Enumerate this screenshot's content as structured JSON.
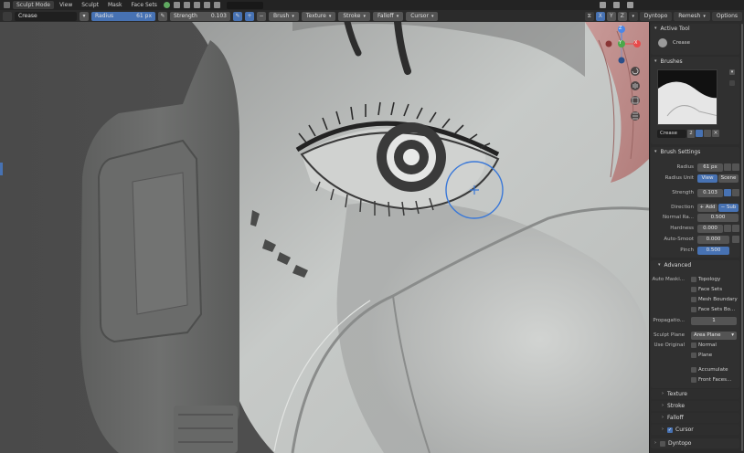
{
  "header": {
    "mode": "Sculpt Mode",
    "menus": [
      "View",
      "Sculpt",
      "Mask",
      "Face Sets"
    ]
  },
  "toolbar": {
    "tool_name": "Crease",
    "radius_label": "Radius",
    "radius_value": "61 px",
    "strength_label": "Strength",
    "strength_value": "0.103",
    "dropdowns": [
      "Brush",
      "Texture",
      "Stroke",
      "Falloff",
      "Cursor"
    ],
    "axes": [
      "X",
      "Y",
      "Z"
    ],
    "dyntopo": "Dyntopo",
    "remesh": "Remesh",
    "options": "Options"
  },
  "gizmo": {
    "x": "X",
    "y": "Y",
    "z": "Z"
  },
  "panel": {
    "active_tool": {
      "title": "Active Tool",
      "tool": "Crease"
    },
    "brushes": {
      "title": "Brushes",
      "brush_name": "Crease",
      "users": "2"
    },
    "brush_settings": {
      "title": "Brush Settings",
      "radius_label": "Radius",
      "radius_value": "61 px",
      "radius_unit_label": "Radius Unit",
      "unit_view": "View",
      "unit_scene": "Scene",
      "strength_label": "Strength",
      "strength_value": "0.103",
      "direction_label": "Direction",
      "dir_add": "+ Add",
      "dir_sub": "− Sub",
      "normal_radius_label": "Normal Ra...",
      "normal_radius_value": "0.500",
      "hardness_label": "Hardness",
      "hardness_value": "0.000",
      "auto_smooth_label": "Auto-Smoot",
      "auto_smooth_value": "0.000",
      "pinch_label": "Pinch",
      "pinch_value": "0.500"
    },
    "advanced": {
      "title": "Advanced",
      "auto_masking_label": "Auto Maski...",
      "mask_topology": "Topology",
      "mask_face_sets": "Face Sets",
      "mask_mesh_boundary": "Mesh Boundary",
      "mask_face_sets_boundary": "Face Sets Bo...",
      "propagation_label": "Propagatio...",
      "propagation_value": "1",
      "sculpt_plane_label": "Sculpt Plane",
      "sculpt_plane_value": "Area Plane",
      "use_original_label": "Use Original",
      "orig_normal": "Normal",
      "orig_plane": "Plane",
      "accumulate": "Accumulate",
      "front_faces": "Front Faces..."
    },
    "collapsed": [
      "Texture",
      "Stroke",
      "Falloff",
      "Cursor"
    ],
    "dyntopo": "Dyntopo"
  },
  "colors": {
    "accent": "#4772b3",
    "panel_bg": "#303030",
    "header_bg": "#232323",
    "brush_circle": "#3a78d8"
  }
}
